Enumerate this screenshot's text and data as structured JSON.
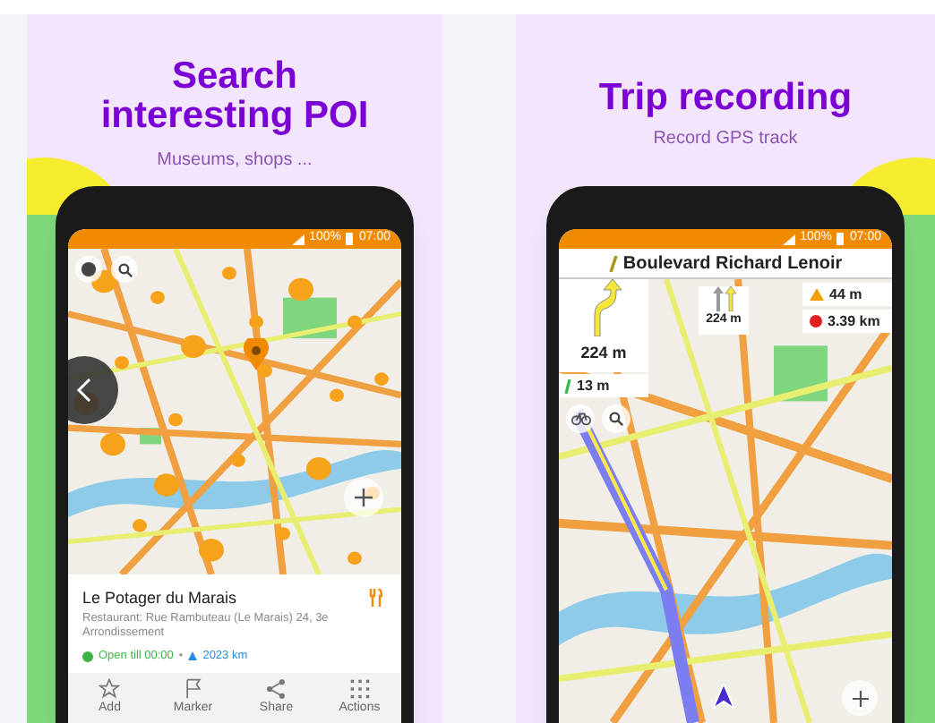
{
  "left_panel": {
    "title": "Search interesting POI",
    "subtitle": "Museums, shops ...",
    "status_bar": {
      "battery": "100%",
      "time": "07:00"
    },
    "poi": {
      "name": "Le Potager du Marais",
      "address": "Restaurant: Rue Rambuteau (Le Marais) 24, 3e Arrondissement",
      "hours": "Open till 00:00",
      "separator": "•",
      "distance": "2023 km"
    },
    "actions": [
      {
        "kind": "star",
        "label": "Add"
      },
      {
        "kind": "flag",
        "label": "Marker"
      },
      {
        "kind": "share",
        "label": "Share"
      },
      {
        "kind": "grid",
        "label": "Actions"
      }
    ]
  },
  "right_panel": {
    "title": "Trip recording",
    "subtitle": "Record GPS track",
    "status_bar": {
      "battery": "100%",
      "time": "07:00"
    },
    "street": "Boulevard Richard Lenoir",
    "turn_distance": "224 m",
    "next_turn_distance": "13 m",
    "lanes_distance": "224 m",
    "alarm_distance": "44 m",
    "remaining_distance": "3.39 km"
  }
}
